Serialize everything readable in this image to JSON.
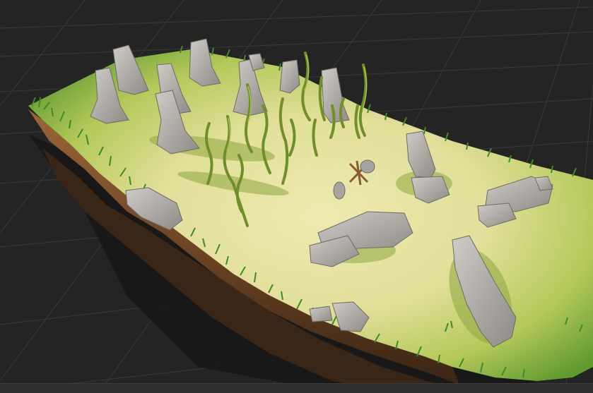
{
  "scene": {
    "view": "perspective-3d-viewport",
    "colors": {
      "background": "#242424",
      "grid_line": "#3c3c3c",
      "ground_light": "#e8e7a6",
      "ground_mid": "#a9c24e",
      "ground_edge": "#4f8a2a",
      "cliff": "#7a4e2b",
      "rock": "#b3b0ab",
      "rock_shadow": "#6e6b67",
      "vine": "#6f8f2a"
    },
    "objects": {
      "standing_stones": 9,
      "lying_stones": 5,
      "edge_rocks": 2,
      "climbing_vines": 14,
      "small_campfire": 1
    }
  }
}
